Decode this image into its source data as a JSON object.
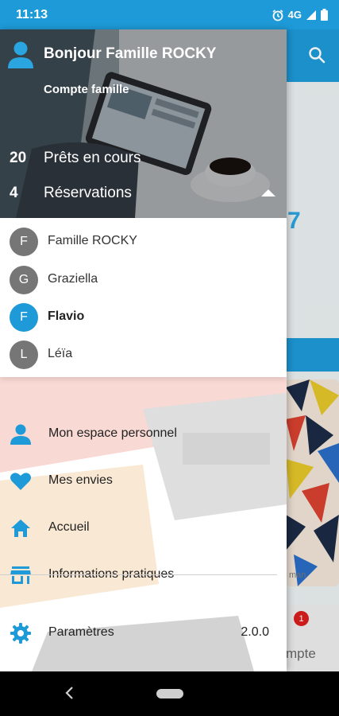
{
  "status_bar": {
    "time": "11:13",
    "network": "4G",
    "background": "#1e9ad8"
  },
  "background_app": {
    "partial_number": "7",
    "partial_caption": "man",
    "tab_badge": "1",
    "partial_tab_label": "mpte"
  },
  "drawer": {
    "header": {
      "greeting": "Bonjour Famille ROCKY",
      "subtitle": "Compte famille",
      "stats": [
        {
          "count": "20",
          "label": "Prêts en cours"
        },
        {
          "count": "4",
          "label": "Réservations"
        }
      ]
    },
    "members": [
      {
        "initial": "F",
        "name": "Famille ROCKY",
        "active": false
      },
      {
        "initial": "G",
        "name": "Graziella",
        "active": false
      },
      {
        "initial": "F",
        "name": "Flavio",
        "active": true
      },
      {
        "initial": "L",
        "name": "Léïa",
        "active": false
      }
    ],
    "menu": [
      {
        "icon": "person-icon",
        "label": "Mon espace personnel"
      },
      {
        "icon": "heart-icon",
        "label": "Mes envies"
      },
      {
        "icon": "home-icon",
        "label": "Accueil"
      },
      {
        "icon": "store-icon",
        "label": "Informations pratiques"
      }
    ],
    "settings": {
      "icon": "gear-icon",
      "label": "Paramètres",
      "version": "2.0.0"
    }
  },
  "colors": {
    "accent": "#1e9ad8",
    "avatar_inactive": "#767676",
    "badge": "#d91d1d"
  }
}
